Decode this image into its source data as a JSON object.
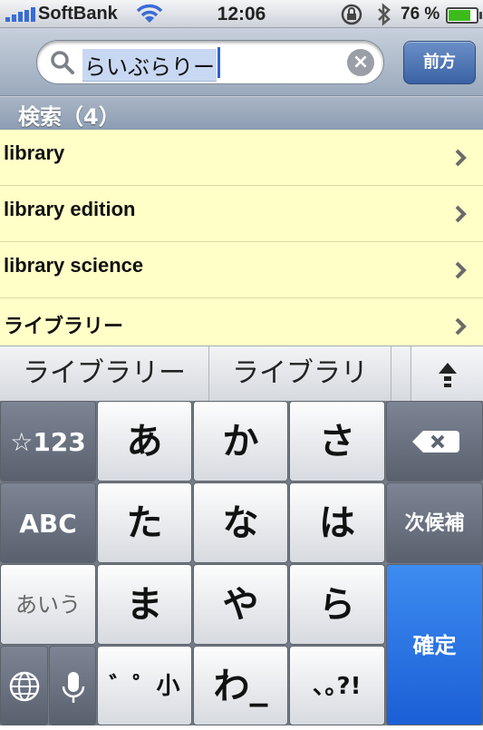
{
  "status_bar": {
    "carrier": "SoftBank",
    "time": "12:06",
    "battery_percent": "76 %",
    "battery_level": 0.76,
    "icons": [
      "signal-bars-icon",
      "wifi-icon",
      "rotation-lock-icon",
      "bluetooth-icon",
      "battery-icon"
    ]
  },
  "search": {
    "query": "らいぶらりー",
    "clear_icon": "×",
    "prev_button": "前方"
  },
  "section": {
    "header": "検索（4）"
  },
  "results": [
    {
      "label": "library"
    },
    {
      "label": "library edition"
    },
    {
      "label": "library science"
    },
    {
      "label": "ライブラリー"
    }
  ],
  "candidates": {
    "items": [
      "ライブラリー",
      "ライブラリ"
    ],
    "expand_icon": "chevron-up-icon"
  },
  "keyboard": {
    "row1": {
      "mode": "☆123",
      "keys": [
        "あ",
        "か",
        "さ"
      ],
      "delete_icon": "backspace-icon"
    },
    "row2": {
      "mode": "ABC",
      "keys": [
        "た",
        "な",
        "は"
      ],
      "action": "次候補"
    },
    "row3": {
      "mode": "あいう",
      "keys": [
        "ま",
        "や",
        "ら"
      ],
      "action": "確定"
    },
    "row4": {
      "globe_icon": "globe-icon",
      "mic_icon": "microphone-icon",
      "keys": [
        "゛゜小",
        "わ_",
        "､｡?!"
      ]
    }
  },
  "colors": {
    "result_background": "#ffffc7",
    "confirm_key": "#2a73e6",
    "nav_bar": "#9aa9bc"
  }
}
